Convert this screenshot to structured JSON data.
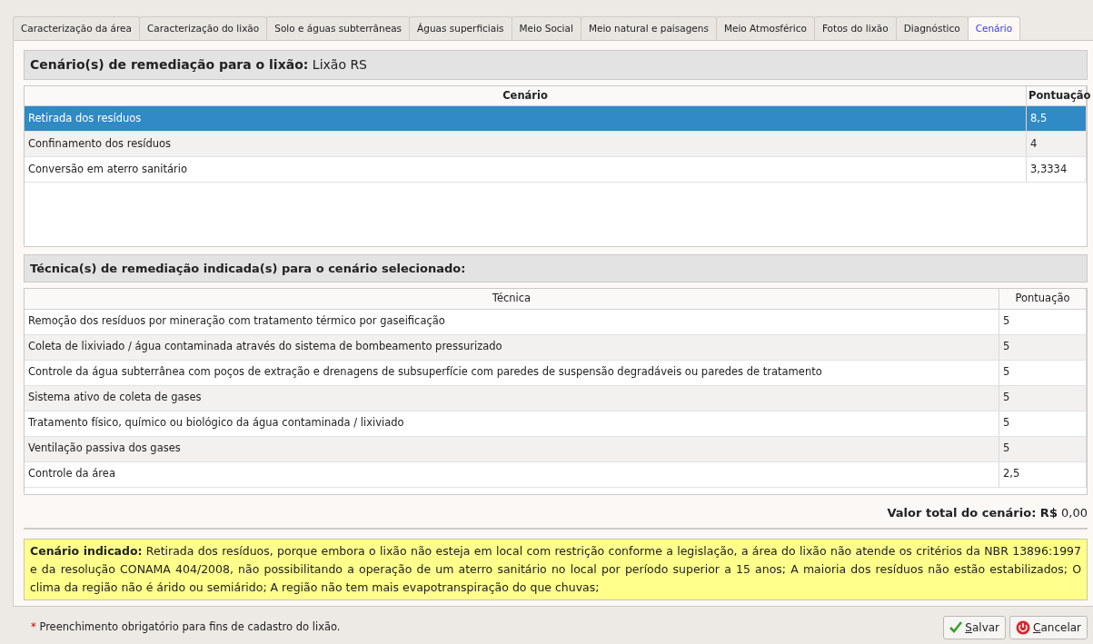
{
  "tabs": [
    {
      "label": "Caracterização da área",
      "selected": false
    },
    {
      "label": "Caracterização do lixão",
      "selected": false
    },
    {
      "label": "Solo e águas subterrâneas",
      "selected": false
    },
    {
      "label": "Águas superficiais",
      "selected": false
    },
    {
      "label": "Meio Social",
      "selected": false
    },
    {
      "label": "Meio natural e paisagens",
      "selected": false
    },
    {
      "label": "Meio Atmosférico",
      "selected": false
    },
    {
      "label": "Fotos do lixão",
      "selected": false
    },
    {
      "label": "Diagnóstico",
      "selected": false
    },
    {
      "label": "Cenário",
      "selected": true
    }
  ],
  "scenarios": {
    "heading": "**Cenário(s) de remediação para o lixão:** Lixão RS",
    "columns": [
      "Cenário",
      "Pontuação"
    ],
    "rows": [
      {
        "cells": [
          "Retirada dos resíduos",
          "8,5"
        ],
        "selected": true
      },
      {
        "cells": [
          "Confinamento dos resíduos",
          "4"
        ],
        "selected": false
      },
      {
        "cells": [
          "Conversão em aterro sanitário",
          "3,3334"
        ],
        "selected": false
      }
    ]
  },
  "techniques": {
    "heading": "Técnica(s) de remediação indicada(s) para o cenário selecionado:",
    "columns": [
      "Técnica",
      "Pontuação"
    ],
    "rows": [
      {
        "cells": [
          "Remoção dos resíduos por mineração com tratamento térmico por gaseificação",
          "5"
        ],
        "selected": false
      },
      {
        "cells": [
          "Coleta de lixiviado / água contaminada através do sistema de bombeamento pressurizado",
          "5"
        ],
        "selected": false
      },
      {
        "cells": [
          "Controle da água subterrânea com poços de extração e drenagens de subsuperfície com paredes de suspensão degradáveis ou paredes de tratamento",
          "5"
        ],
        "selected": false
      },
      {
        "cells": [
          "Sistema ativo de coleta de gases",
          "5"
        ],
        "selected": false
      },
      {
        "cells": [
          "Tratamento físico, químico ou biológico da água contaminada / lixiviado",
          "5"
        ],
        "selected": false
      },
      {
        "cells": [
          "Ventilação passiva dos gases",
          "5"
        ],
        "selected": false
      },
      {
        "cells": [
          "Controle da área",
          "2,5"
        ],
        "selected": false
      }
    ]
  },
  "total": "**Valor total do cenário: R$** 0,00",
  "recommendation": "**Cenário indicado:** Retirada dos resíduos, porque embora o lixão não esteja em local com restrição conforme a legislação, a área do lixão não atende os critérios da NBR 13896:1997 e da resolução CONAMA 404/2008, não possibilitando a operação de um aterro sanitário no local por período superior a 15 anos; A maioria dos resíduos não estão estabilizados; O clima da região não é árido ou semiárido; A região não tem mais evapotranspiração do que chuvas;",
  "footer": {
    "asterisk": "*",
    "note": "Preenchimento obrigatório para fins de cadastro do lixão."
  },
  "buttons": [
    {
      "kind": "save",
      "label": "Salvar",
      "first_letter_underlined": true
    },
    {
      "kind": "cancel",
      "label": "Cancelar",
      "first_letter_underlined": true
    }
  ]
}
